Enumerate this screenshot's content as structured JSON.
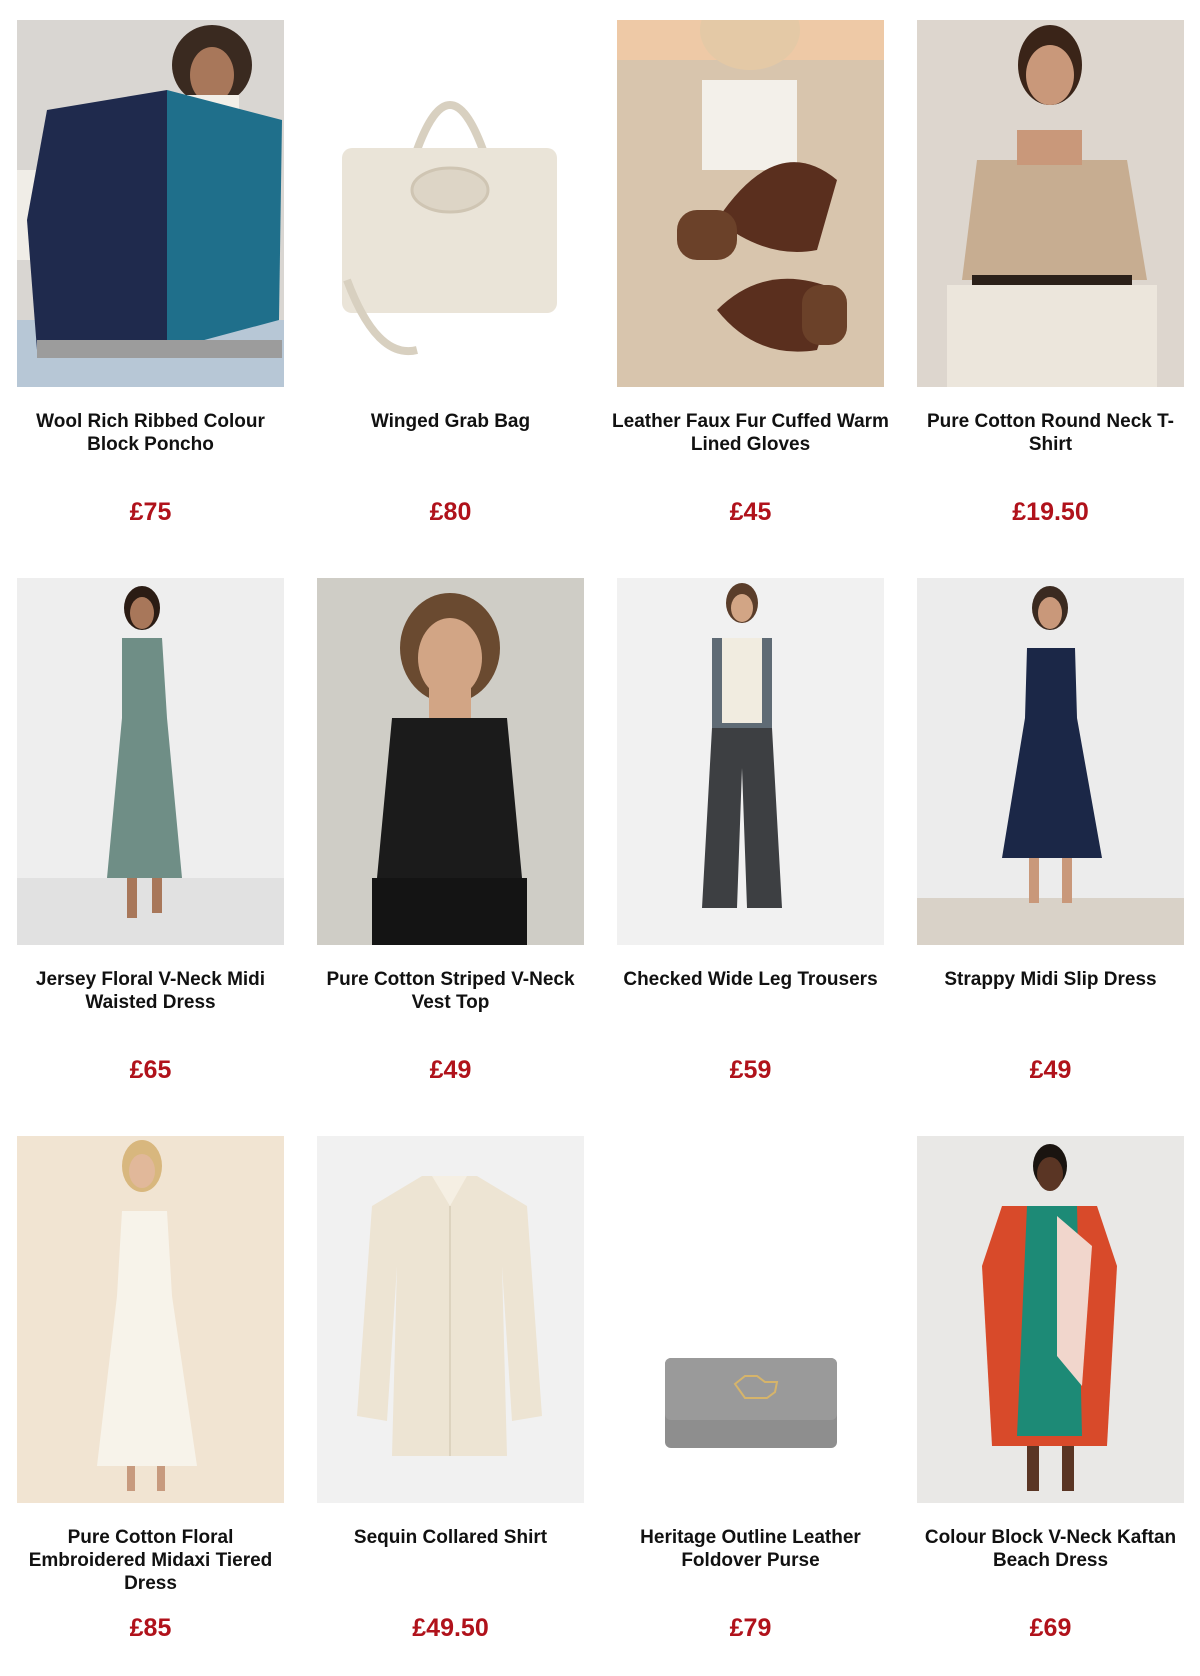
{
  "products": [
    {
      "name": "Wool Rich Ribbed Colour Block Poncho",
      "price": "£75",
      "image_icon": "poncho-photo"
    },
    {
      "name": "Winged Grab Bag",
      "price": "£80",
      "image_icon": "handbag-photo"
    },
    {
      "name": "Leather Faux Fur Cuffed Warm Lined Gloves",
      "price": "£45",
      "image_icon": "gloves-photo"
    },
    {
      "name": "Pure Cotton Round Neck T-Shirt",
      "price": "£19.50",
      "image_icon": "tshirt-photo"
    },
    {
      "name": "Jersey Floral V-Neck Midi Waisted Dress",
      "price": "£65",
      "image_icon": "floral-dress-photo"
    },
    {
      "name": "Pure Cotton Striped V-Neck Vest Top",
      "price": "£49",
      "image_icon": "vest-top-photo"
    },
    {
      "name": "Checked Wide Leg Trousers",
      "price": "£59",
      "image_icon": "trousers-photo"
    },
    {
      "name": "Strappy Midi Slip Dress",
      "price": "£49",
      "image_icon": "slip-dress-photo"
    },
    {
      "name": "Pure Cotton Floral Embroidered Midaxi Tiered Dress",
      "price": "£85",
      "image_icon": "tiered-dress-photo"
    },
    {
      "name": "Sequin Collared Shirt",
      "price": "£49.50",
      "image_icon": "sequin-shirt-photo"
    },
    {
      "name": "Heritage Outline Leather Foldover Purse",
      "price": "£79",
      "image_icon": "purse-photo"
    },
    {
      "name": "Colour Block V-Neck Kaftan Beach Dress",
      "price": "£69",
      "image_icon": "kaftan-photo"
    }
  ],
  "colors": {
    "price": "#b0121b",
    "name": "#111111",
    "background": "#ffffff"
  }
}
